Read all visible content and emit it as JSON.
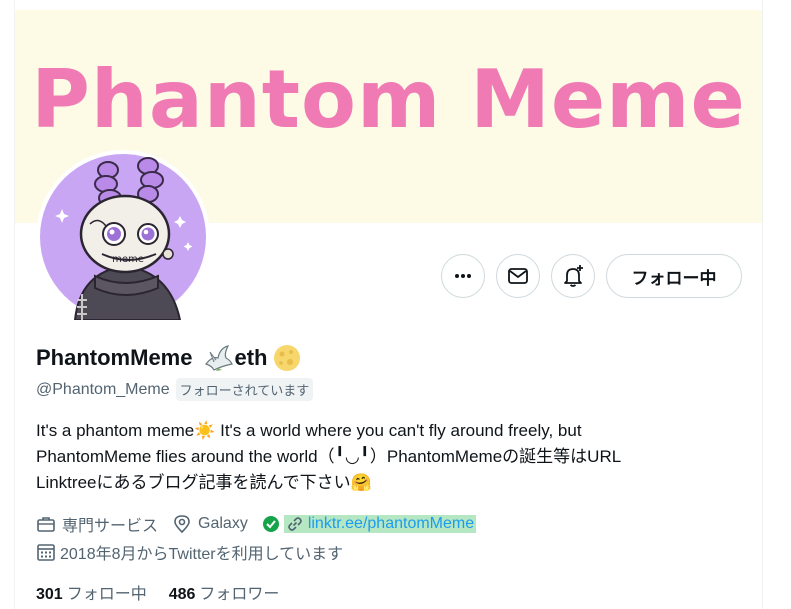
{
  "banner": {
    "title": "Phantom Meme"
  },
  "profile": {
    "display_name": "PhantomMeme",
    "display_name_suffix": "eth",
    "handle": "@Phantom_Meme",
    "follows_you": "フォローされています",
    "bio_line1": "It's a phantom meme☀️ It's a world where you can't fly around freely, but",
    "bio_line2": "PhantomMeme flies around the world（╹◡╹）PhantomMemeの誕生等はURL",
    "bio_line3": "Linktreeにあるブログ記事を読んで下さい🤗",
    "category": "専門サービス",
    "location": "Galaxy",
    "link": "linktr.ee/phantomMeme",
    "joined": "2018年8月からTwitterを利用しています",
    "following_count": "301",
    "following_label": "フォロー中",
    "followers_count": "486",
    "followers_label": "フォロワー"
  },
  "actions": {
    "follow_button": "フォロー中"
  },
  "colors": {
    "banner_bg": "#fdfae6",
    "banner_text": "#f07ab4",
    "avatar_bg": "#c9a6f3",
    "link": "#1d9bf0",
    "verified": "#17a34a"
  }
}
